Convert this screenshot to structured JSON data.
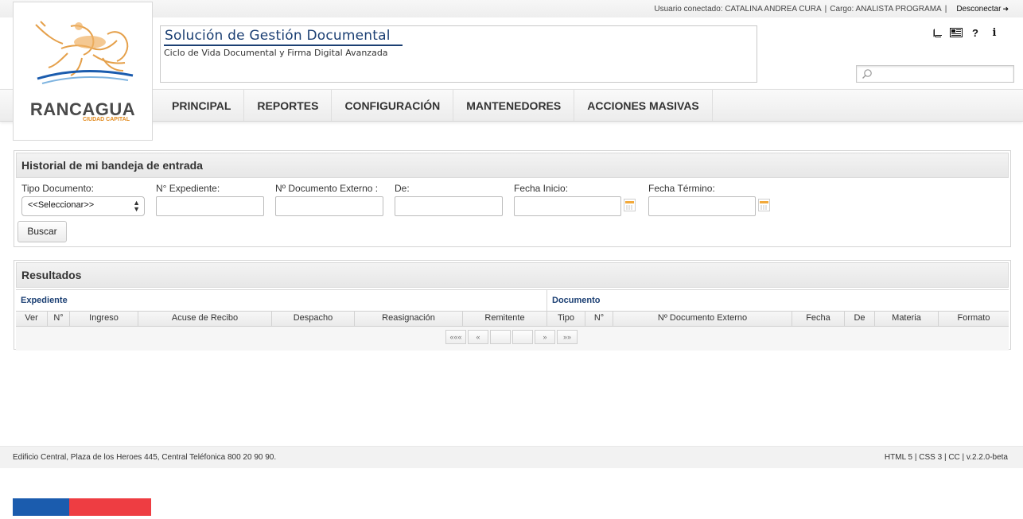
{
  "topbar": {
    "user_text": "Usuario conectado: CATALINA ANDREA CURA",
    "role_text": "Cargo: ANALISTA PROGRAMA",
    "logout_label": "Desconectar"
  },
  "logo": {
    "name": "RANCAGUA",
    "tagline": "CIUDAD CAPITAL"
  },
  "header": {
    "title": "Solución de Gestión Documental",
    "subtitle": "Ciclo de Vida Documental y Firma Digital Avanzada",
    "icons": [
      "book-icon",
      "newspaper-icon",
      "help-icon",
      "info-icon"
    ],
    "help_glyph": "?",
    "info_glyph": "i",
    "search_placeholder": ""
  },
  "nav": {
    "items": [
      "PRINCIPAL",
      "REPORTES",
      "CONFIGURACIÓN",
      "MANTENEDORES",
      "ACCIONES MASIVAS"
    ]
  },
  "filters": {
    "title": "Historial de mi bandeja de entrada",
    "tipo_label": "Tipo Documento:",
    "tipo_value": "<<Seleccionar>>",
    "expediente_label": "N° Expediente:",
    "doc_externo_label": "Nº Documento Externo :",
    "de_label": "De:",
    "fecha_inicio_label": "Fecha Inicio:",
    "fecha_termino_label": "Fecha Término:",
    "search_button": "Buscar"
  },
  "results": {
    "title": "Resultados",
    "group_expediente": "Expediente",
    "group_documento": "Documento",
    "columns": [
      "Ver",
      "N°",
      "Ingreso",
      "Acuse de Recibo",
      "Despacho",
      "Reasignación",
      "Remitente",
      "Tipo",
      "N°",
      "Nº Documento Externo",
      "Fecha",
      "De",
      "Materia",
      "Formato"
    ],
    "pager": {
      "first": "«««",
      "prev": "«",
      "next": "»",
      "last": "»»"
    }
  },
  "footer": {
    "address": "Edificio Central, Plaza de los Heroes 445, Central Teléfonica 800 20 90 90.",
    "tech": "HTML 5 | CSS 3 | CC | v.2.2.0-beta"
  },
  "colors": {
    "title_blue": "#1b3f73",
    "flag_blue": "#1b5cae",
    "flag_red": "#ee3d42",
    "logo_orange": "#e28a1d"
  }
}
